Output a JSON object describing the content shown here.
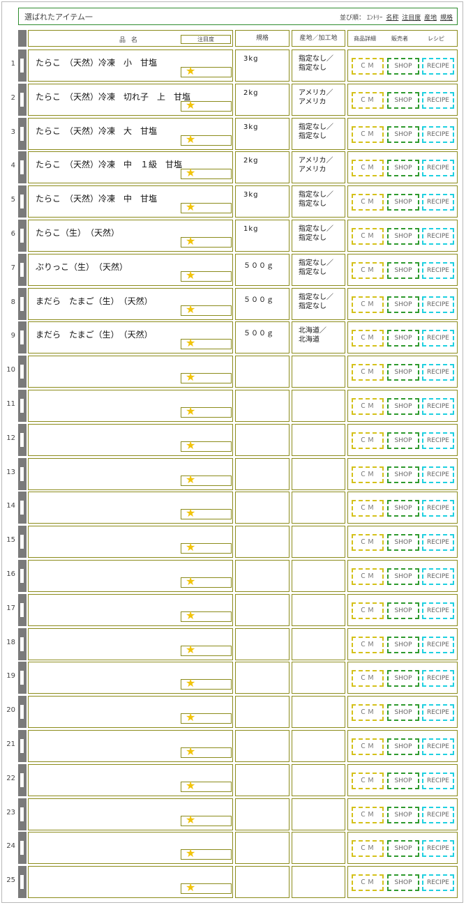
{
  "header": {
    "title": "選ばれたアイテム一",
    "sort_prefix": "並び順：",
    "sort_entry": "ｴﾝﾄﾘｰ",
    "sort_links": [
      "名称",
      "注目度",
      "産地",
      "規格"
    ]
  },
  "columns": {
    "name": "品名",
    "attention": "注目度",
    "spec": "規格",
    "origin": "産地／加工地",
    "detail": "商品詳細",
    "seller": "販売者",
    "recipe": "レシピ"
  },
  "buttons": {
    "cm": "ＣＭ",
    "shop": "SHOP",
    "recipe": "RECIPE"
  },
  "star_glyph": "★",
  "rows": [
    {
      "no": "1",
      "name": "たらこ　（天然）冷凍　小　甘塩",
      "spec": "3kg",
      "origin": "指定なし／\n指定なし"
    },
    {
      "no": "2",
      "name": "たらこ　（天然）冷凍　切れ子　上　甘塩",
      "spec": "2kg",
      "origin": "アメリカ／\nアメリカ"
    },
    {
      "no": "3",
      "name": "たらこ　（天然）冷凍　大　甘塩",
      "spec": "3kg",
      "origin": "指定なし／\n指定なし"
    },
    {
      "no": "4",
      "name": "たらこ　（天然）冷凍　中　１級　甘塩",
      "spec": "2kg",
      "origin": "アメリカ／\nアメリカ"
    },
    {
      "no": "5",
      "name": "たらこ　（天然）冷凍　中　甘塩",
      "spec": "3kg",
      "origin": "指定なし／\n指定なし"
    },
    {
      "no": "6",
      "name": "たらこ（生）　（天然）",
      "spec": "1kg",
      "origin": "指定なし／\n指定なし"
    },
    {
      "no": "7",
      "name": "ぶりっこ（生）　（天然）",
      "spec": "５００ｇ",
      "origin": "指定なし／\n指定なし"
    },
    {
      "no": "8",
      "name": "まだら　たまご（生）　（天然）",
      "spec": "５００ｇ",
      "origin": "指定なし／\n指定なし"
    },
    {
      "no": "9",
      "name": "まだら　たまご（生）　（天然）",
      "spec": "５００ｇ",
      "origin": "北海道／\n北海道"
    },
    {
      "no": "10",
      "name": "",
      "spec": "",
      "origin": ""
    },
    {
      "no": "11",
      "name": "",
      "spec": "",
      "origin": ""
    },
    {
      "no": "12",
      "name": "",
      "spec": "",
      "origin": ""
    },
    {
      "no": "13",
      "name": "",
      "spec": "",
      "origin": ""
    },
    {
      "no": "14",
      "name": "",
      "spec": "",
      "origin": ""
    },
    {
      "no": "15",
      "name": "",
      "spec": "",
      "origin": ""
    },
    {
      "no": "16",
      "name": "",
      "spec": "",
      "origin": ""
    },
    {
      "no": "17",
      "name": "",
      "spec": "",
      "origin": ""
    },
    {
      "no": "18",
      "name": "",
      "spec": "",
      "origin": ""
    },
    {
      "no": "19",
      "name": "",
      "spec": "",
      "origin": ""
    },
    {
      "no": "20",
      "name": "",
      "spec": "",
      "origin": ""
    },
    {
      "no": "21",
      "name": "",
      "spec": "",
      "origin": ""
    },
    {
      "no": "22",
      "name": "",
      "spec": "",
      "origin": ""
    },
    {
      "no": "23",
      "name": "",
      "spec": "",
      "origin": ""
    },
    {
      "no": "24",
      "name": "",
      "spec": "",
      "origin": ""
    },
    {
      "no": "25",
      "name": "",
      "spec": "",
      "origin": ""
    }
  ]
}
